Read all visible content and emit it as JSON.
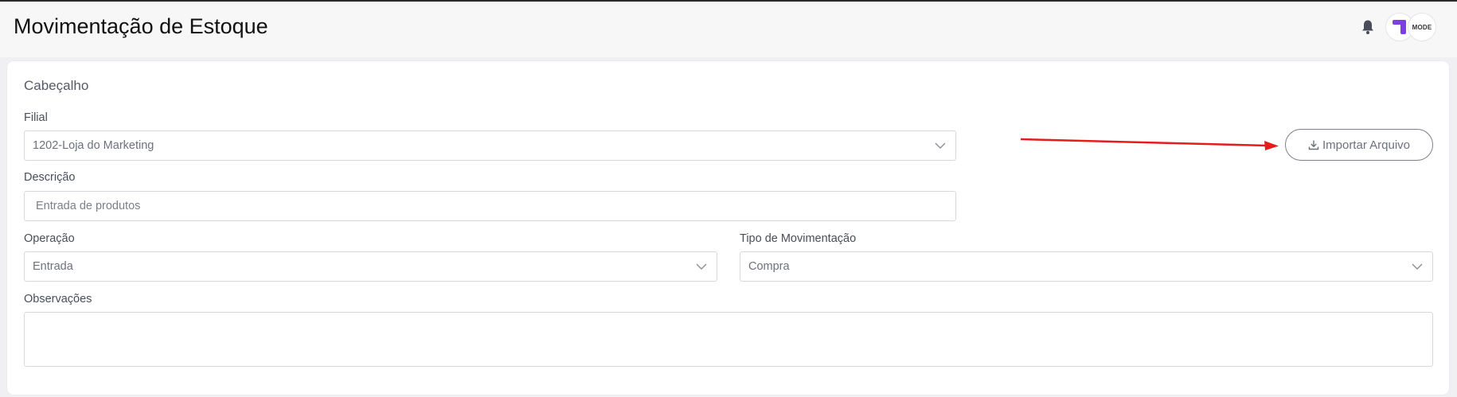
{
  "header": {
    "title": "Movimentação de Estoque",
    "bell_icon": "bell-icon",
    "avatar_left_icon": "brand-logo-icon",
    "avatar_right_text": "MODE"
  },
  "form": {
    "section_title": "Cabeçalho",
    "filial": {
      "label": "Filial",
      "value": "1202-Loja do Marketing"
    },
    "descricao": {
      "label": "Descrição",
      "value": "Entrada de produtos"
    },
    "operacao": {
      "label": "Operação",
      "value": "Entrada"
    },
    "tipo": {
      "label": "Tipo de Movimentação",
      "value": "Compra"
    },
    "observacoes": {
      "label": "Observações",
      "value": ""
    },
    "import_button": {
      "label": "Importar Arquivo",
      "icon": "download-icon"
    }
  },
  "colors": {
    "brand_purple": "#7b3fe4",
    "annotation_arrow": "#e51c1c"
  }
}
